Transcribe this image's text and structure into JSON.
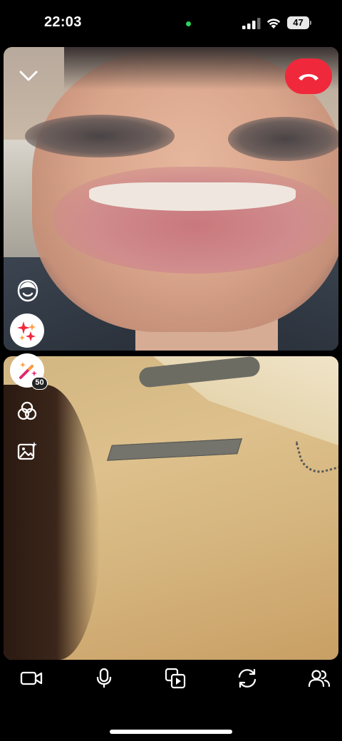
{
  "status_bar": {
    "time": "22:03",
    "battery_level": "47",
    "camera_indicator_color": "#31d158"
  },
  "call": {
    "end_call_color": "#f0283c",
    "lens_count_badge": "50"
  },
  "icons": {
    "collapse": "chevron-down-icon",
    "end_call": "phone-hangup-icon",
    "bitmoji": "bitmoji-face-icon",
    "sparkle": "sparkles-icon",
    "lens": "magic-wand-icon",
    "filters": "filter-circles-icon",
    "gallery": "image-sparkle-icon",
    "video": "video-camera-icon",
    "mic": "microphone-icon",
    "share_media": "share-media-icon",
    "flip": "flip-camera-icon",
    "participants": "participants-icon"
  }
}
